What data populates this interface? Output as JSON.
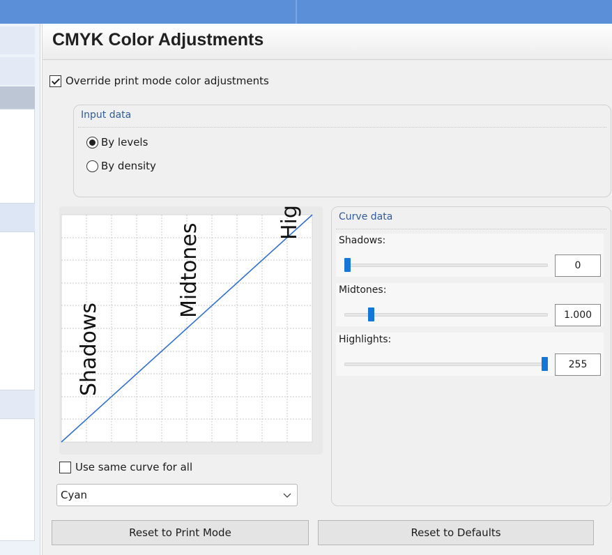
{
  "window": {
    "title": "CMYK Color Adjustments"
  },
  "override": {
    "label": "Override print mode color adjustments",
    "checked": true
  },
  "input_data": {
    "title": "Input data",
    "options": [
      {
        "label": "By levels",
        "selected": true
      },
      {
        "label": "By density",
        "selected": false
      }
    ]
  },
  "chart_labels": {
    "shadows": "Shadows",
    "midtones": "Midtones",
    "highlights": "Highlights"
  },
  "curve_data": {
    "title": "Curve data",
    "rows": [
      {
        "label": "Shadows:",
        "value": "0",
        "fraction": 0.0
      },
      {
        "label": "Midtones:",
        "value": "1.000",
        "fraction": 0.12
      },
      {
        "label": "Highlights:",
        "value": "255",
        "fraction": 1.0
      }
    ]
  },
  "same_curve": {
    "label": "Use same curve for all",
    "checked": false
  },
  "channel_select": {
    "value": "Cyan"
  },
  "buttons": {
    "reset_print_mode": "Reset to Print Mode",
    "reset_defaults": "Reset to Defaults"
  },
  "colors": {
    "accent": "#1477d8",
    "title_bar": "#5b8fd8",
    "group_title": "#2f5b9a",
    "curve_line": "#2f6fd6"
  },
  "icons": {
    "select_arrow": "chevron-down-icon"
  }
}
